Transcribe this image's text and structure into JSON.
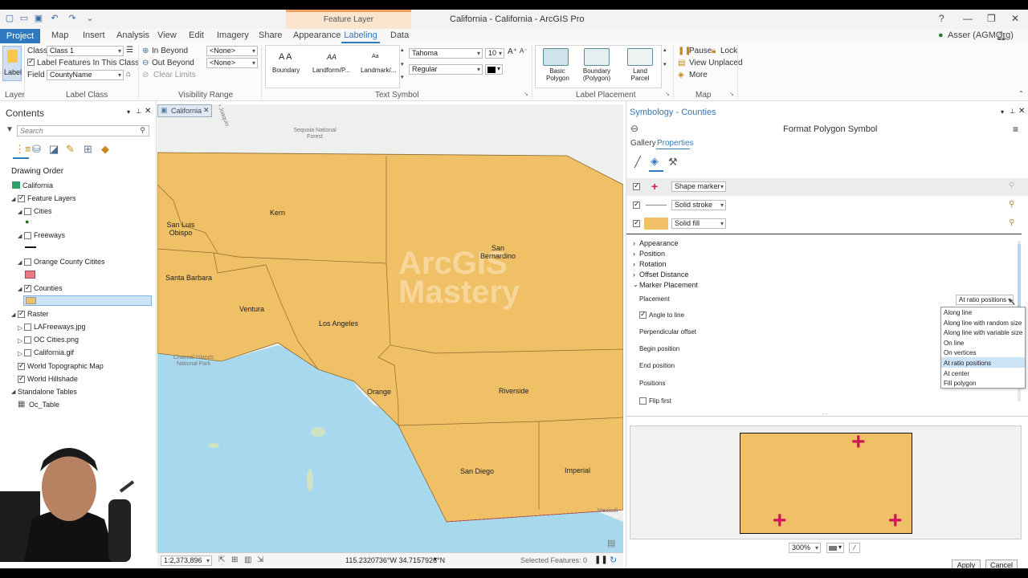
{
  "window": {
    "title": "California - California - ArcGIS Pro",
    "context_tab": "Feature Layer",
    "user": "Asser (AGMOrg)"
  },
  "tabs": [
    "Project",
    "Map",
    "Insert",
    "Analysis",
    "View",
    "Edit",
    "Imagery",
    "Share",
    "Appearance",
    "Labeling",
    "Data"
  ],
  "ribbon": {
    "layer": {
      "label_button": "Label",
      "group": "Layer"
    },
    "label_class": {
      "class_label": "Class",
      "class_value": "Class 1",
      "label_features": "Label Features In This Class",
      "field_label": "Field",
      "field_value": "CountyName",
      "group": "Label Class"
    },
    "visibility": {
      "in_beyond": "In Beyond",
      "out_beyond": "Out Beyond",
      "clear_limits": "Clear Limits",
      "none1": "<None>",
      "none2": "<None>",
      "group": "Visibility Range"
    },
    "text_symbol": {
      "styles": [
        "Boundary",
        "Landform/P...",
        "Landmark/..."
      ],
      "font": "Tahoma",
      "size": "10",
      "style": "Regular",
      "group": "Text Symbol"
    },
    "placement": {
      "styles": [
        "Basic Polygon",
        "Boundary (Polygon)",
        "Land Parcel"
      ],
      "group": "Label Placement"
    },
    "map": {
      "pause": "Pause",
      "lock": "Lock",
      "view_unplaced": "View Unplaced",
      "more": "More",
      "group": "Map"
    }
  },
  "contents": {
    "title": "Contents",
    "search_placeholder": "Search",
    "drawing_order": "Drawing Order",
    "items": {
      "california": "California",
      "feature_layers": "Feature Layers",
      "cities": "Cities",
      "freeways": "Freeways",
      "orange_county": "Orange County Citites",
      "counties": "Counties",
      "raster": "Raster",
      "la_freeways": "LAFreeways.jpg",
      "oc_cities": "OC Cities.png",
      "california_gif": "California.gif",
      "world_topo": "World Topographic Map",
      "world_hillshade": "World Hillshade",
      "standalone_tables": "Standalone Tables",
      "oc_table": "Oc_Table"
    }
  },
  "map": {
    "tab": "California",
    "counties": [
      "Kern",
      "San Luis Obispo",
      "San Bernardino",
      "Santa Barbara",
      "Ventura",
      "Los Angeles",
      "Orange",
      "Riverside",
      "San Diego",
      "Imperial"
    ],
    "features": {
      "sequoia": "Sequoia National Forest",
      "san_joaquin": "San Joaquin",
      "channel_islands": "Channel Islands National Park",
      "mexicali": "Mexicali"
    },
    "watermark": "ArcGIS Mastery",
    "scale": "1:2,373,896",
    "coords": "115.2320736°W 34.7157926°N",
    "selected": "Selected Features: 0"
  },
  "symbology": {
    "title": "Symbology - Counties",
    "subtitle": "Format Polygon Symbol",
    "tabs": {
      "gallery": "Gallery",
      "properties": "Properties"
    },
    "layers": {
      "marker": "Shape marker",
      "stroke": "Solid stroke",
      "fill": "Solid fill"
    },
    "sections": {
      "appearance": "Appearance",
      "position": "Position",
      "rotation": "Rotation",
      "offset": "Offset Distance",
      "marker_placement": "Marker Placement"
    },
    "props": {
      "placement": "Placement",
      "placement_value": "At ratio positions",
      "angle_to_line": "Angle to line",
      "perp_offset": "Perpendicular offset",
      "begin": "Begin position",
      "end": "End position",
      "positions": "Positions",
      "flip_first": "Flip first"
    },
    "dropdown_options": [
      "Along line",
      "Along line with random size",
      "Along line with variable size",
      "On line",
      "On vertices",
      "At ratio positions",
      "At center",
      "Fill polygon"
    ],
    "dropdown_selected_index": 5,
    "zoom": "300%",
    "apply": "Apply",
    "cancel": "Cancel"
  },
  "colors": {
    "accent": "#2f79c0",
    "county_fill": "#f0c066",
    "marker": "#d4145a",
    "ocean": "#a8d8ee"
  }
}
